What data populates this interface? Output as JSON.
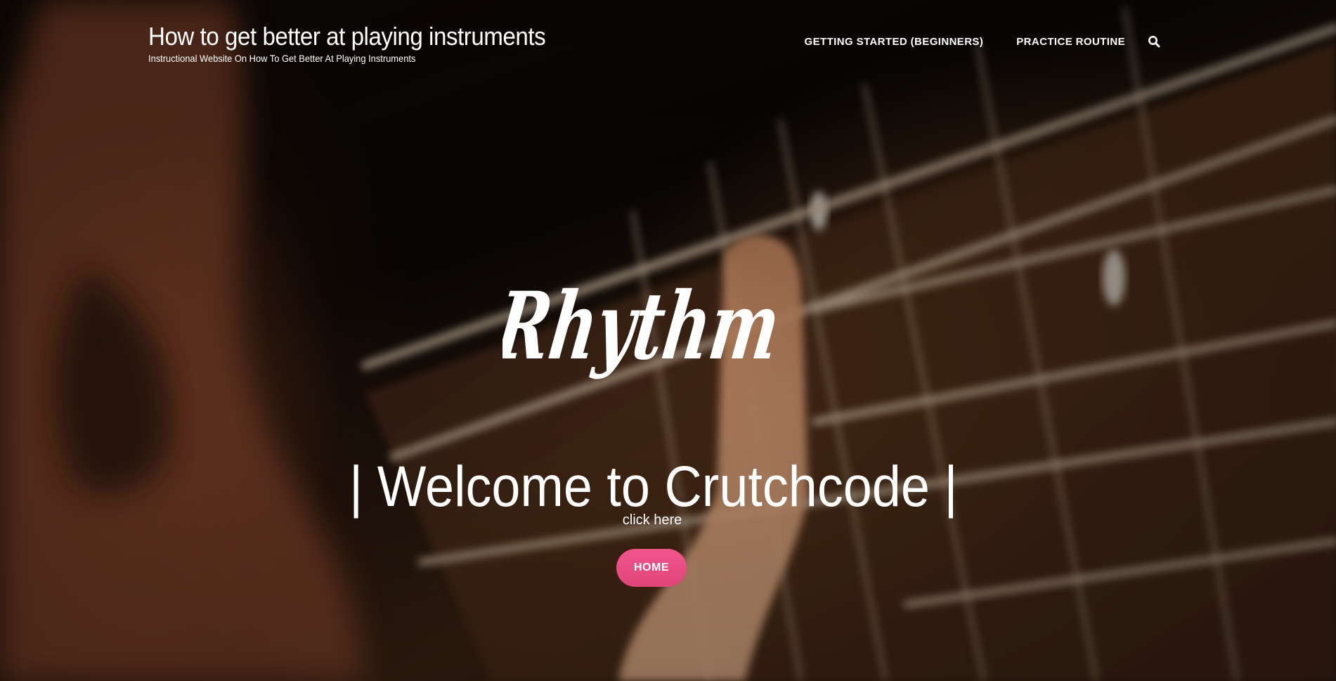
{
  "header": {
    "site_title": "How to get better at playing instruments",
    "site_description": "Instructional Website On How To Get Better At Playing Instruments",
    "nav": [
      {
        "label": "GETTING STARTED (BEGINNERS)"
      },
      {
        "label": "PRACTICE ROUTINE"
      }
    ],
    "search_icon": "search-icon"
  },
  "hero": {
    "script_word": "Rhythm",
    "headline": "| Welcome to Crutchcode |",
    "subtext": "click here",
    "button_label": "HOME"
  },
  "colors": {
    "button": "#e94d82",
    "text": "#ffffff"
  }
}
